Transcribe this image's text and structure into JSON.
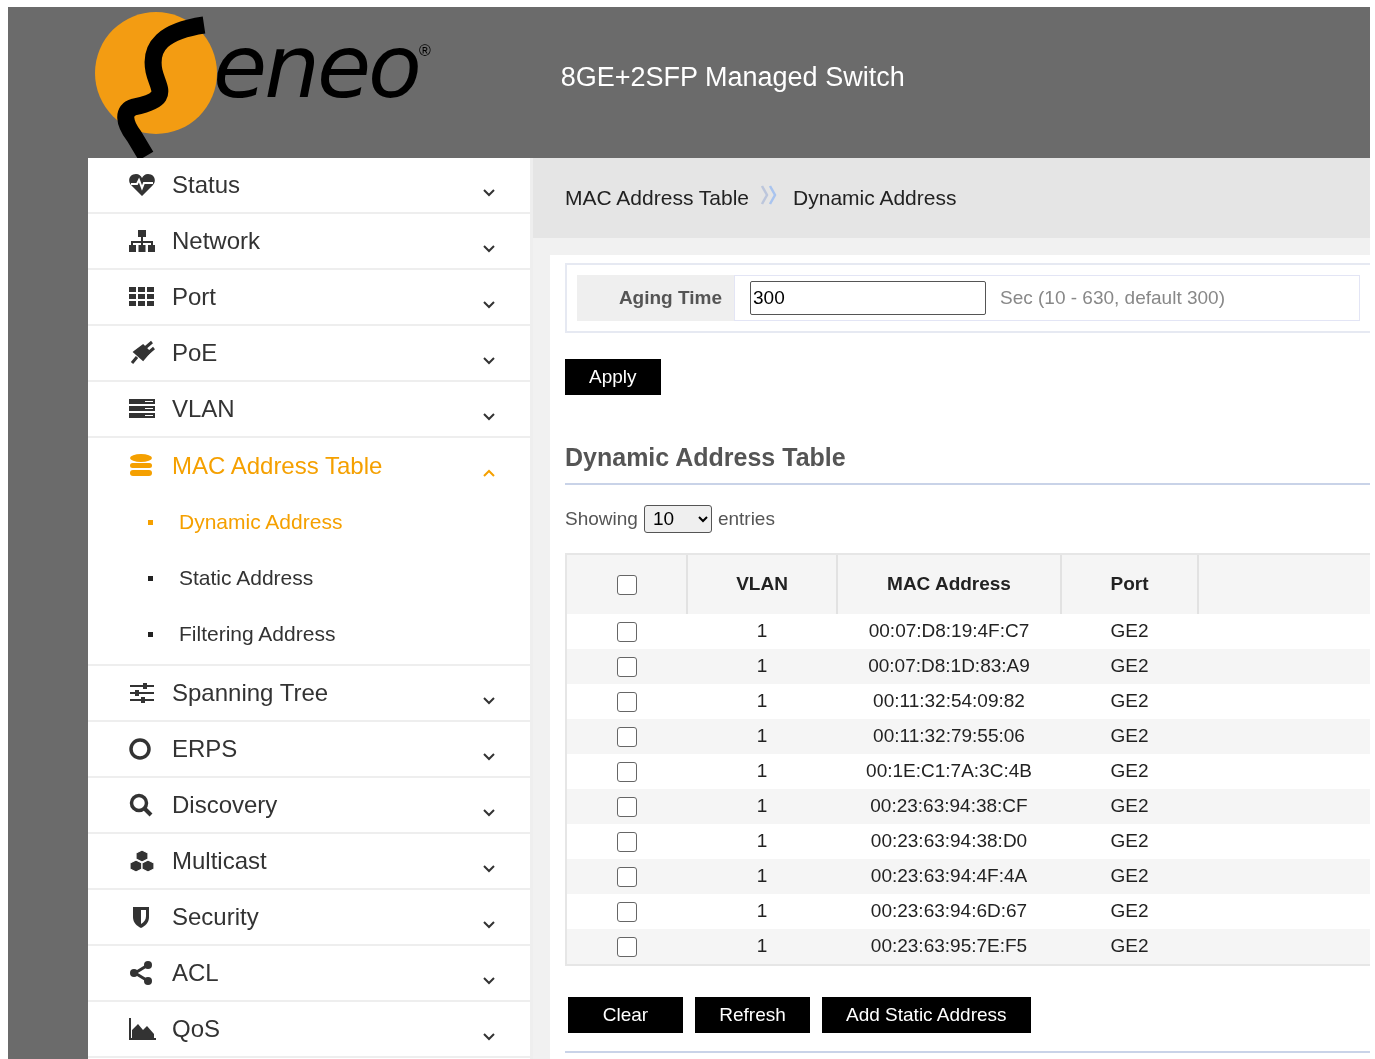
{
  "header": {
    "logo_text": "eneo",
    "logo_mark": "®",
    "title": "8GE+2SFP Managed Switch"
  },
  "sidebar": {
    "items": [
      {
        "label": "Status",
        "expanded": false,
        "selected": false
      },
      {
        "label": "Network",
        "expanded": false,
        "selected": false
      },
      {
        "label": "Port",
        "expanded": false,
        "selected": false
      },
      {
        "label": "PoE",
        "expanded": false,
        "selected": false
      },
      {
        "label": "VLAN",
        "expanded": false,
        "selected": false
      },
      {
        "label": "MAC Address Table",
        "expanded": true,
        "selected": true,
        "children": [
          {
            "label": "Dynamic Address",
            "selected": true
          },
          {
            "label": "Static Address",
            "selected": false
          },
          {
            "label": "Filtering Address",
            "selected": false
          }
        ]
      },
      {
        "label": "Spanning Tree",
        "expanded": false,
        "selected": false
      },
      {
        "label": "ERPS",
        "expanded": false,
        "selected": false
      },
      {
        "label": "Discovery",
        "expanded": false,
        "selected": false
      },
      {
        "label": "Multicast",
        "expanded": false,
        "selected": false
      },
      {
        "label": "Security",
        "expanded": false,
        "selected": false
      },
      {
        "label": "ACL",
        "expanded": false,
        "selected": false
      },
      {
        "label": "QoS",
        "expanded": false,
        "selected": false
      }
    ]
  },
  "breadcrumb": [
    "MAC Address Table",
    "Dynamic Address"
  ],
  "aging": {
    "label": "Aging Time",
    "value": "300",
    "hint": "Sec (10 - 630, default 300)"
  },
  "apply_button": "Apply",
  "section_title": "Dynamic Address Table",
  "page_size": {
    "before": "Showing",
    "value": "10",
    "after": "entries"
  },
  "table": {
    "select_all_checked": false,
    "columns": [
      "VLAN",
      "MAC Address",
      "Port"
    ],
    "rows": [
      {
        "checked": false,
        "cells": [
          "1",
          "00:07:D8:19:4F:C7",
          "GE2"
        ]
      },
      {
        "checked": false,
        "cells": [
          "1",
          "00:07:D8:1D:83:A9",
          "GE2"
        ]
      },
      {
        "checked": false,
        "cells": [
          "1",
          "00:11:32:54:09:82",
          "GE2"
        ]
      },
      {
        "checked": false,
        "cells": [
          "1",
          "00:11:32:79:55:06",
          "GE2"
        ]
      },
      {
        "checked": false,
        "cells": [
          "1",
          "00:1E:C1:7A:3C:4B",
          "GE2"
        ]
      },
      {
        "checked": false,
        "cells": [
          "1",
          "00:23:63:94:38:CF",
          "GE2"
        ]
      },
      {
        "checked": false,
        "cells": [
          "1",
          "00:23:63:94:38:D0",
          "GE2"
        ]
      },
      {
        "checked": false,
        "cells": [
          "1",
          "00:23:63:94:4F:4A",
          "GE2"
        ]
      },
      {
        "checked": false,
        "cells": [
          "1",
          "00:23:63:94:6D:67",
          "GE2"
        ]
      },
      {
        "checked": false,
        "cells": [
          "1",
          "00:23:63:95:7E:F5",
          "GE2"
        ]
      }
    ]
  },
  "buttons": [
    "Clear",
    "Refresh",
    "Add Static Address"
  ]
}
